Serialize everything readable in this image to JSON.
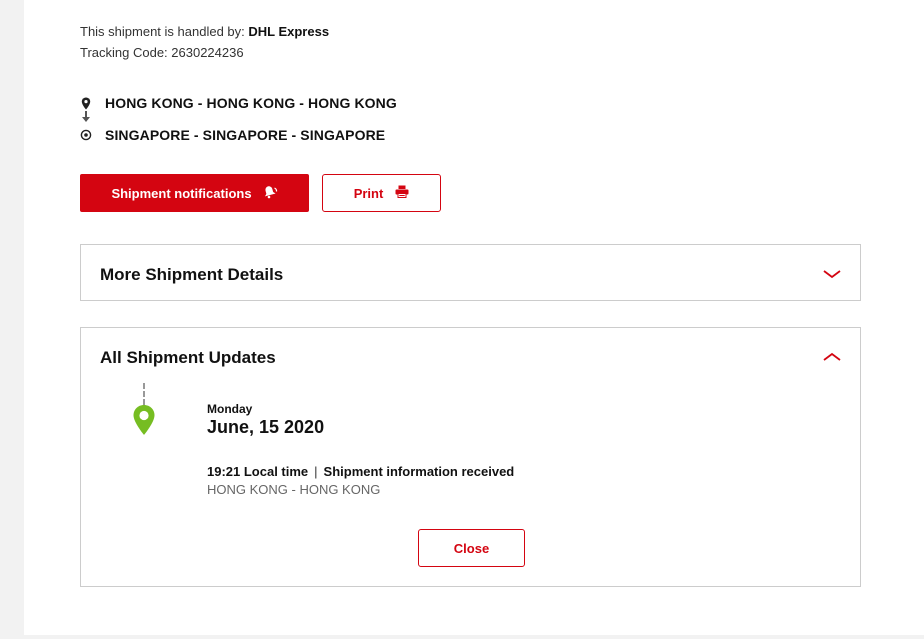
{
  "shipment": {
    "handled_prefix": "This shipment is handled by: ",
    "carrier": "DHL Express",
    "tracking_prefix": "Tracking Code: ",
    "tracking_code": "2630224236"
  },
  "route": {
    "origin": "HONG KONG - HONG KONG - HONG KONG",
    "destination": "SINGAPORE - SINGAPORE - SINGAPORE",
    "origin_icon": "map-pin-icon",
    "destination_icon": "target-circle-icon"
  },
  "actions": {
    "notifications_label": "Shipment notifications",
    "print_label": "Print"
  },
  "details_panel": {
    "title": "More Shipment Details",
    "expanded": false
  },
  "updates_panel": {
    "title": "All Shipment Updates",
    "expanded": true,
    "events": [
      {
        "weekday": "Monday",
        "date": "June, 15 2020",
        "time": "19:21 Local time",
        "separator": "|",
        "description": "Shipment information received",
        "location": "HONG KONG - HONG KONG"
      }
    ],
    "close_label": "Close"
  },
  "colors": {
    "brand_red": "#d40511",
    "pin_green": "#76bd22",
    "border": "#cccccc"
  }
}
